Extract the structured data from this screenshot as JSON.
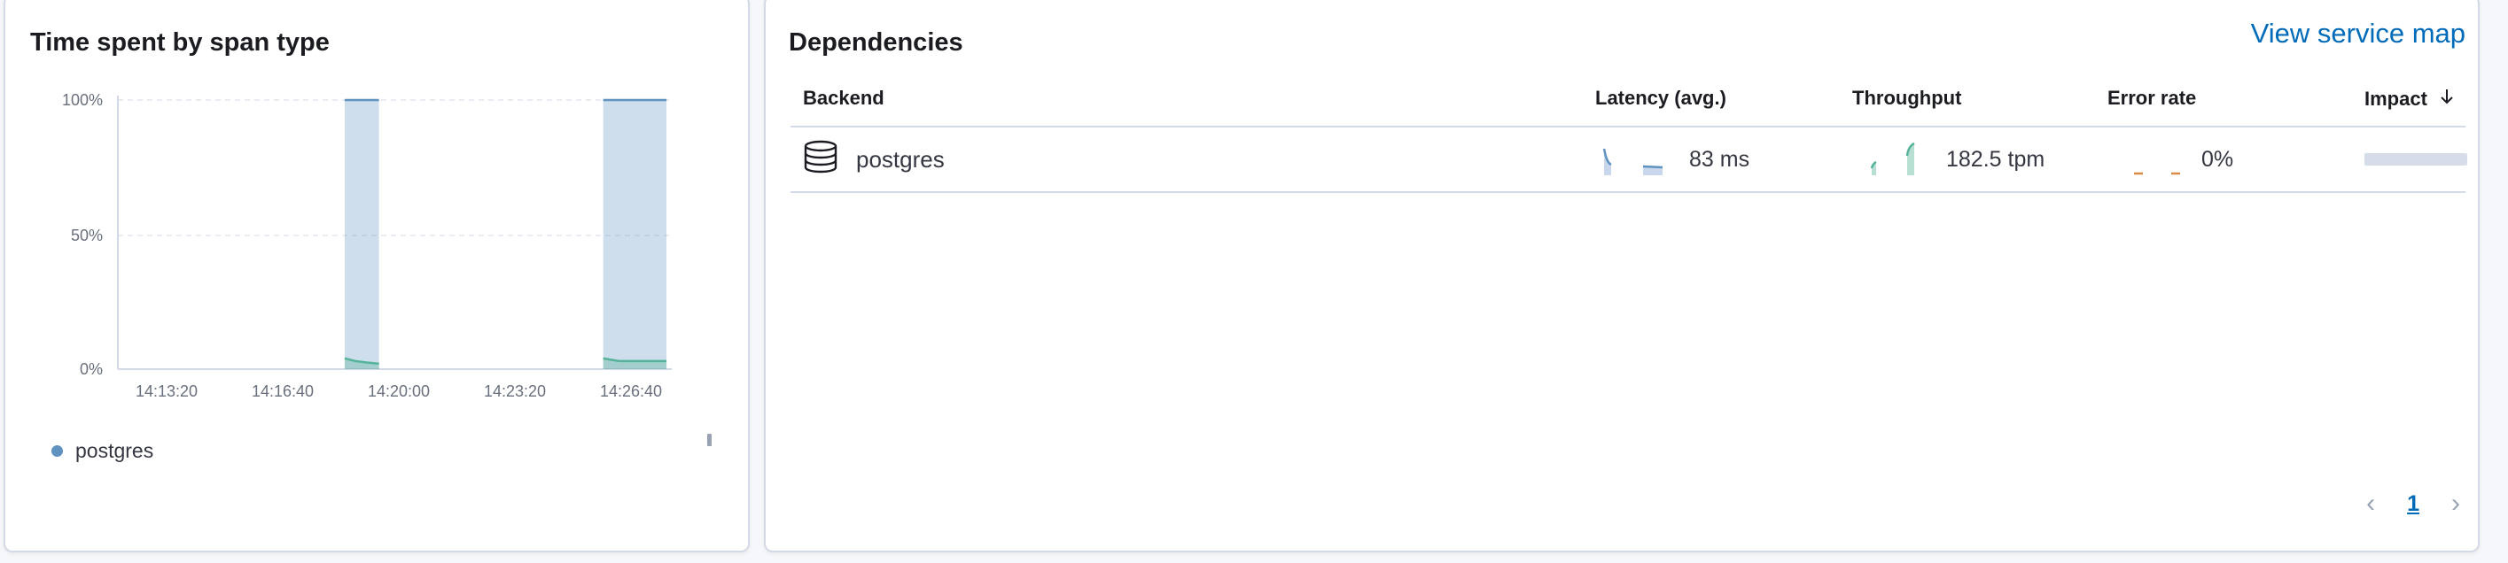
{
  "time_spent_panel": {
    "title": "Time spent by span type",
    "legend": [
      {
        "label": "postgres",
        "color": "#6092c0"
      }
    ]
  },
  "chart_data": {
    "type": "area",
    "title": "Time spent by span type",
    "xlabel": "",
    "ylabel": "",
    "y_ticks": [
      "100%",
      "50%",
      "0%"
    ],
    "x_ticks": [
      "14:13:20",
      "14:16:40",
      "14:20:00",
      "14:23:20",
      "14:26:40"
    ],
    "ylim": [
      0,
      1
    ],
    "stacked": true,
    "normalized": true,
    "grid": true,
    "legend_position": "bottom-left",
    "series": [
      {
        "name": "postgres",
        "color": "#6092c0",
        "x": [
          "14:18:40",
          "14:19:00",
          "14:19:20",
          "14:19:45"
        ],
        "values": [
          1.0,
          1.0,
          1.0,
          1.0
        ]
      },
      {
        "color": "#54b399",
        "x": [
          "14:18:40",
          "14:19:00",
          "14:19:20",
          "14:19:45"
        ],
        "values": [
          0.04,
          0.03,
          0.025,
          0.02
        ]
      },
      {
        "name": "postgres",
        "color": "#6092c0",
        "x": [
          "14:26:50",
          "14:27:20",
          "14:28:00",
          "14:28:50"
        ],
        "values": [
          1.0,
          1.0,
          1.0,
          1.0
        ]
      },
      {
        "color": "#54b399",
        "x": [
          "14:26:50",
          "14:27:20",
          "14:28:00",
          "14:28:50"
        ],
        "values": [
          0.04,
          0.03,
          0.03,
          0.03
        ]
      }
    ]
  },
  "dependencies_panel": {
    "title": "Dependencies",
    "view_map_link": "View service map",
    "columns": {
      "backend": "Backend",
      "latency": "Latency (avg.)",
      "throughput": "Throughput",
      "error_rate": "Error rate",
      "impact": "Impact"
    },
    "sort_icon": "arrow-down-icon",
    "rows": [
      {
        "backend_icon": "database-icon",
        "backend": "postgres",
        "latency": "83 ms",
        "throughput": "182.5 tpm",
        "error_rate": "0%",
        "impact": 1.0
      }
    ],
    "pagination": {
      "current_page": "1"
    }
  },
  "colors": {
    "link": "#006bb8",
    "latency": "#6092c0",
    "throughput": "#54b399",
    "error_rate": "#da8b45",
    "impact_bar": "#d6dde9"
  }
}
